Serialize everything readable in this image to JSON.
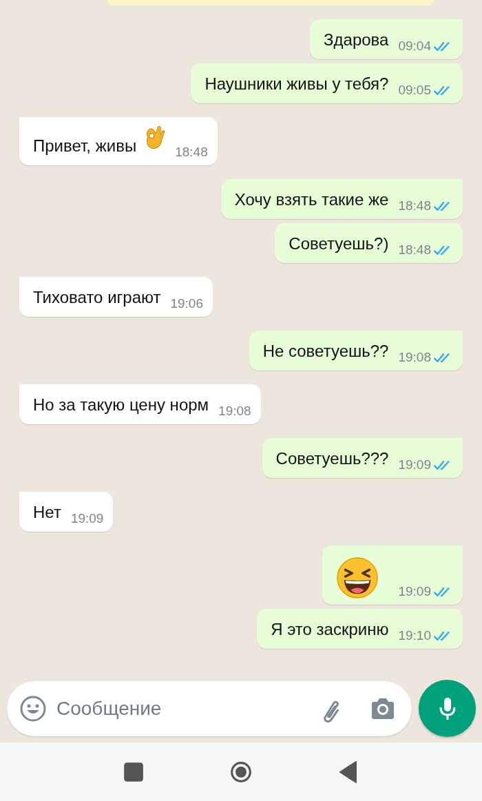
{
  "messages": [
    {
      "kind": "sent",
      "text": "Здарова",
      "time": "09:04",
      "read": true
    },
    {
      "kind": "sent",
      "text": "Наушники живы у тебя?",
      "time": "09:05",
      "read": true
    },
    {
      "kind": "okhand",
      "text": "Привет, живы",
      "time": "18:48"
    },
    {
      "kind": "sent",
      "text": "Хочу взять такие же",
      "time": "18:48",
      "read": true
    },
    {
      "kind": "sent",
      "text": "Советуешь?)",
      "time": "18:48",
      "read": true
    },
    {
      "kind": "received",
      "text": "Тиховато играют",
      "time": "19:06"
    },
    {
      "kind": "sent",
      "text": "Не советуешь??",
      "time": "19:08",
      "read": true
    },
    {
      "kind": "received",
      "text": "Но за такую цену норм",
      "time": "19:08"
    },
    {
      "kind": "sent",
      "text": "Советуешь???",
      "time": "19:09",
      "read": true
    },
    {
      "kind": "received",
      "text": "Нет",
      "time": "19:09"
    },
    {
      "kind": "laugh",
      "time": "19:09",
      "read": true
    },
    {
      "kind": "sent",
      "text": "Я это заскриню",
      "time": "19:10",
      "read": true
    }
  ],
  "composer": {
    "placeholder": "Сообщение"
  }
}
